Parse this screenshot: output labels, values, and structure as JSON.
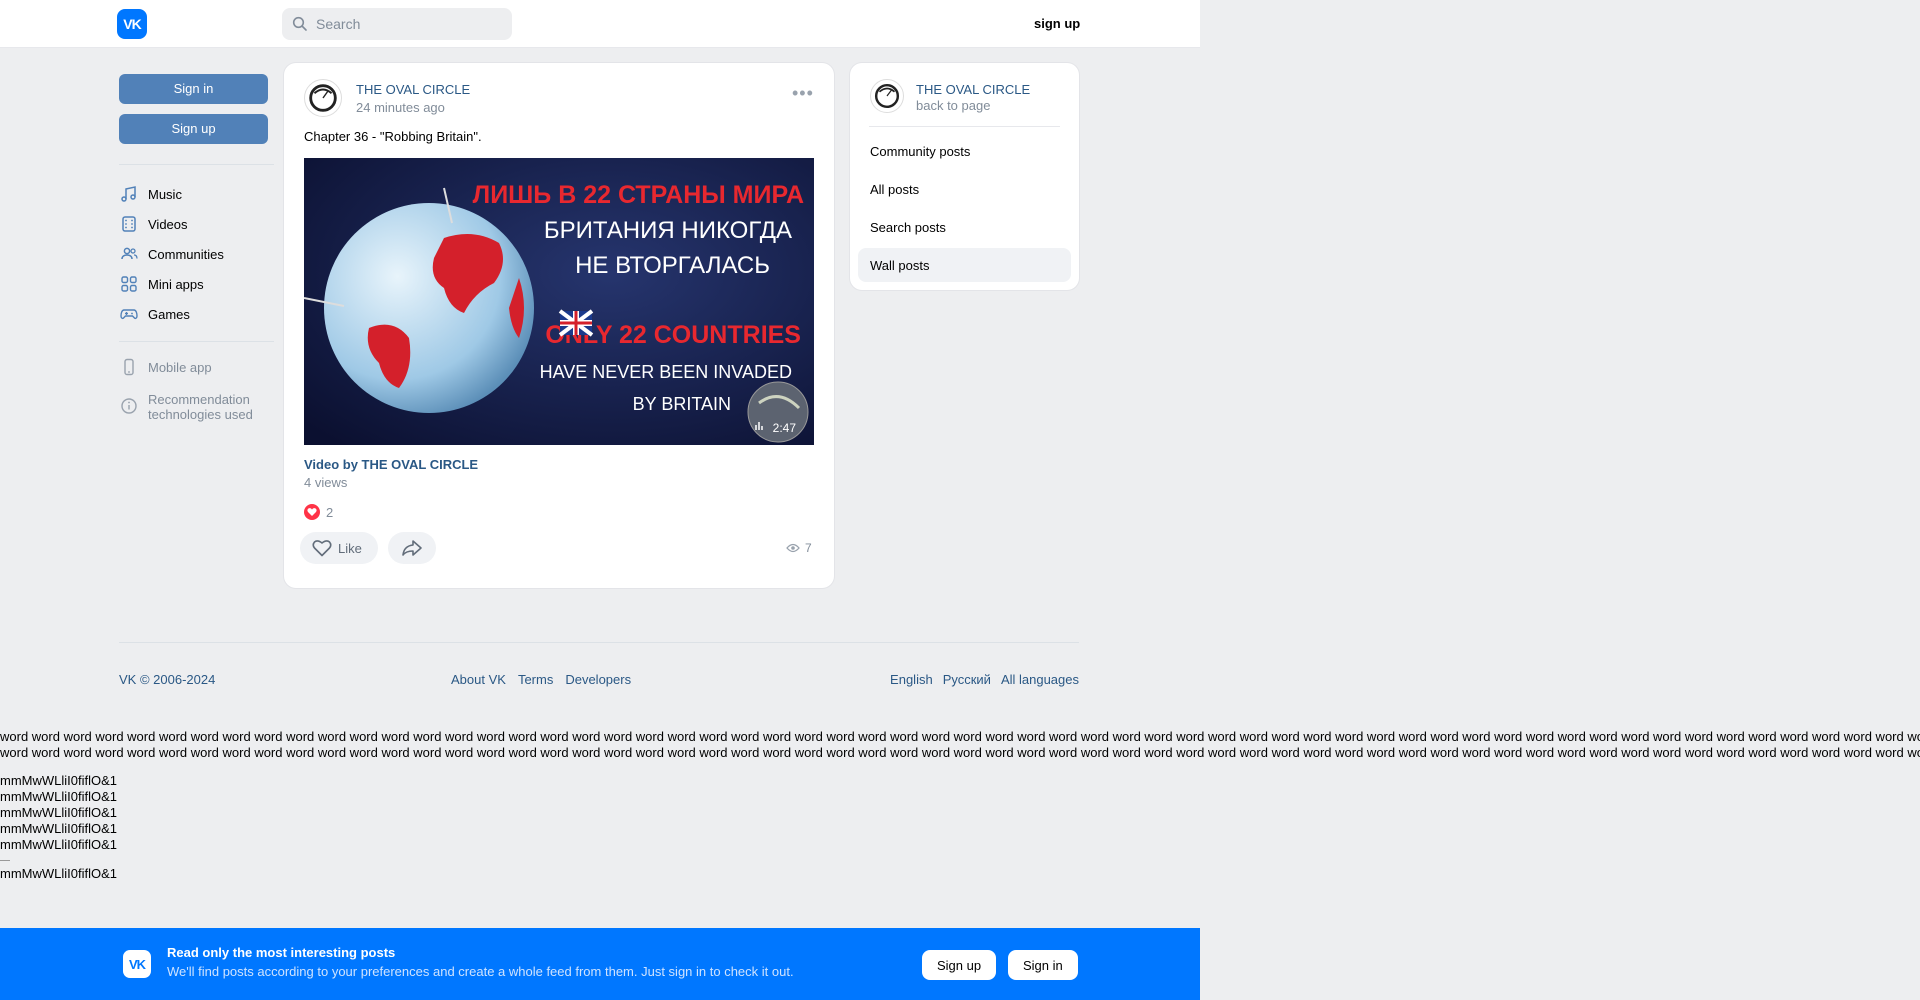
{
  "header": {
    "logo": "VK",
    "search_placeholder": "Search",
    "signup_link": "sign up"
  },
  "left_nav": {
    "sign_in": "Sign in",
    "sign_up": "Sign up",
    "items": [
      {
        "label": "Music",
        "icon": "music-icon"
      },
      {
        "label": "Videos",
        "icon": "video-icon"
      },
      {
        "label": "Communities",
        "icon": "communities-icon"
      },
      {
        "label": "Mini apps",
        "icon": "mini-apps-icon"
      },
      {
        "label": "Games",
        "icon": "gamepad-icon"
      }
    ],
    "mobile_app": "Mobile app",
    "recommendation": "Recommendation technologies used"
  },
  "post": {
    "author": "THE OVAL CIRCLE",
    "time": "24 minutes ago",
    "text": "Chapter 36 - \"Robbing Britain\".",
    "video": {
      "line_ru_1": "ЛИШЬ В 22 СТРАНЫ МИРА",
      "line_ru_2": "БРИТАНИЯ НИКОГДА",
      "line_ru_3": "НЕ ВТОРГАЛАСЬ",
      "line_en_1": "ONLY 22 COUNTRIES",
      "line_en_2": "HAVE NEVER BEEN INVADED",
      "line_en_3": "BY BRITAIN",
      "duration": "2:47"
    },
    "video_title": "Video by THE OVAL CIRCLE",
    "video_views": "4 views",
    "reactions_count": "2",
    "like_label": "Like",
    "views_count": "7"
  },
  "right_sidebar": {
    "name": "THE OVAL CIRCLE",
    "back": "back to page",
    "menu": [
      {
        "label": "Community posts",
        "active": false
      },
      {
        "label": "All posts",
        "active": false
      },
      {
        "label": "Search posts",
        "active": false
      },
      {
        "label": "Wall posts",
        "active": true
      }
    ]
  },
  "footer": {
    "copyright": "VK © 2006-2024",
    "links": [
      "About VK",
      "Terms",
      "Developers"
    ],
    "languages": [
      "English",
      "Русский",
      "All languages"
    ]
  },
  "test_text": {
    "word": "word",
    "glyph_line": "mmMwWLliI0fiflO&1"
  },
  "banner": {
    "title": "Read only the most interesting posts",
    "subtitle": "We'll find posts according to your preferences and create a whole feed from them. Just sign in to check it out.",
    "sign_up": "Sign up",
    "sign_in": "Sign in"
  },
  "colors": {
    "vk_blue": "#0077ff",
    "button_blue": "#5181b8",
    "link_blue": "#2a5885",
    "background": "#edeef0",
    "heart_red": "#ff3347"
  }
}
